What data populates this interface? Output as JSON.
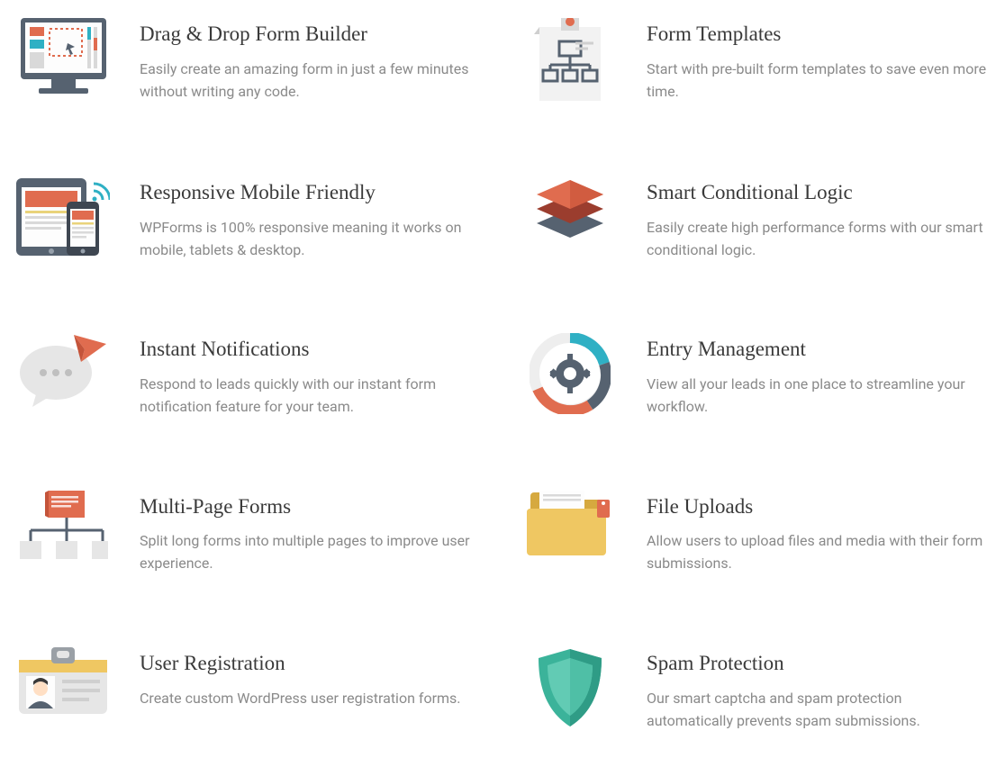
{
  "features": [
    {
      "title": "Drag & Drop Form Builder",
      "desc": "Easily create an amazing form in just a few minutes without writing any code."
    },
    {
      "title": "Form Templates",
      "desc": "Start with pre-built form templates to save even more time."
    },
    {
      "title": "Responsive Mobile Friendly",
      "desc": "WPForms is 100% responsive meaning it works on mobile, tablets & desktop."
    },
    {
      "title": "Smart Conditional Logic",
      "desc": "Easily create high performance forms with our smart conditional logic."
    },
    {
      "title": "Instant Notifications",
      "desc": "Respond to leads quickly with our instant form notification feature for your team."
    },
    {
      "title": "Entry Management",
      "desc": "View all your leads in one place to streamline your workflow."
    },
    {
      "title": "Multi-Page Forms",
      "desc": "Split long forms into multiple pages to improve user experience."
    },
    {
      "title": "File Uploads",
      "desc": "Allow users to upload files and media with their form submissions."
    },
    {
      "title": "User Registration",
      "desc": "Create custom WordPress user registration forms."
    },
    {
      "title": "Spam Protection",
      "desc": "Our smart captcha and spam protection automatically prevents spam submissions."
    }
  ]
}
